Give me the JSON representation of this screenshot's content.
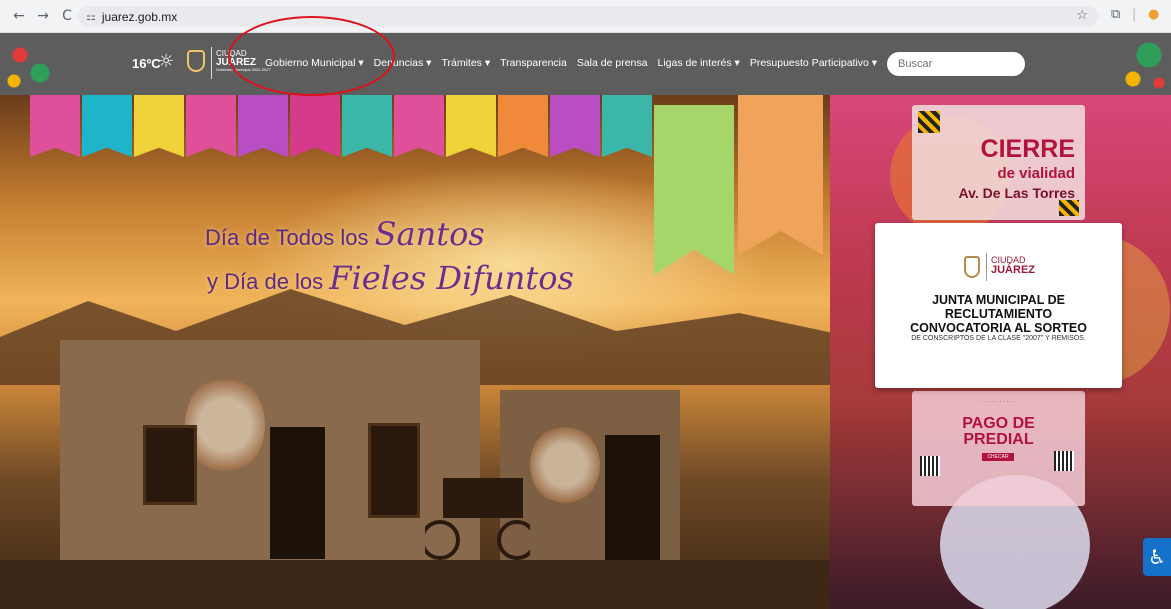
{
  "browser": {
    "back_icon": "←",
    "forward_icon": "→",
    "reload_icon": "C",
    "site_info_icon": "⚏",
    "url": "juarez.gob.mx",
    "star_icon": "☆",
    "extensions_icon": "⧉",
    "separator": "|",
    "profile_icon": "●"
  },
  "nav": {
    "temperature": "16ºC",
    "weather_icon": "☼",
    "logo": {
      "line1": "CIUDAD",
      "line2": "JUÁREZ",
      "line3": "Gobierno Municipal 2024-2027"
    },
    "items": [
      {
        "label": "Gobierno Municipal ▾"
      },
      {
        "label": "Denuncias ▾"
      },
      {
        "label": "Trámites ▾"
      },
      {
        "label": "Transparencia"
      },
      {
        "label": "Sala de prensa"
      },
      {
        "label": "Ligas de interés ▾"
      },
      {
        "label": "Presupuesto Participativo ▾"
      }
    ],
    "search_placeholder": "Buscar"
  },
  "hero": {
    "line1_plain": "Día de Todos los ",
    "line1_script": "Santos",
    "line2_plain": "y Día de los ",
    "line2_script": "Fieles Difuntos"
  },
  "cards": {
    "cierre": {
      "title": "CIERRE",
      "subtitle": "de vialidad",
      "location": "Av. De Las Torres"
    },
    "junta": {
      "logo_line1": "CIUDAD",
      "logo_line2": "JUÁREZ",
      "heading_line1": "JUNTA MUNICIPAL DE",
      "heading_line2": "RECLUTAMIENTO",
      "heading_line3": "CONVOCATORIA AL SORTEO",
      "subtext": "DE CONSCRIPTOS DE LA CLASE \"2007\" Y REMISOS."
    },
    "predial": {
      "line1": "PAGO DE",
      "line2": "PREDIAL",
      "button": "CHECAR"
    }
  },
  "accessibility_icon": "♿"
}
